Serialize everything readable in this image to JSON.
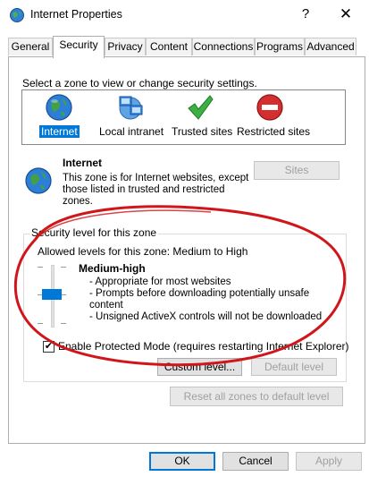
{
  "window": {
    "title": "Internet Properties",
    "help": "?",
    "close": "✕"
  },
  "tabs": [
    {
      "label": "General"
    },
    {
      "label": "Security",
      "active": true
    },
    {
      "label": "Privacy"
    },
    {
      "label": "Content"
    },
    {
      "label": "Connections"
    },
    {
      "label": "Programs"
    },
    {
      "label": "Advanced"
    }
  ],
  "security": {
    "zone_prompt": "Select a zone to view or change security settings.",
    "zones": [
      {
        "label": "Internet",
        "icon": "globe-icon",
        "selected": true
      },
      {
        "label": "Local intranet",
        "icon": "computers-icon"
      },
      {
        "label": "Trusted sites",
        "icon": "checkmark-icon"
      },
      {
        "label": "Restricted sites",
        "icon": "no-entry-icon"
      }
    ],
    "zone_info": {
      "title": "Internet",
      "description": "This zone is for Internet websites, except those listed in trusted and restricted zones."
    },
    "sites_button": "Sites",
    "group_legend": "Security level for this zone",
    "allowed_levels": "Allowed levels for this zone: Medium to High",
    "level": {
      "name": "Medium-high",
      "bullets": [
        "- Appropriate for most websites",
        "- Prompts before downloading potentially unsafe",
        "content",
        "- Unsigned ActiveX controls will not be downloaded"
      ]
    },
    "protected_mode": {
      "label": "Enable Protected Mode (requires restarting Internet Explorer)",
      "checked": true,
      "check_glyph": "✔"
    },
    "custom_level_button": "Custom level...",
    "default_level_button": "Default level",
    "reset_all_button": "Reset all zones to default level"
  },
  "footer": {
    "ok": "OK",
    "cancel": "Cancel",
    "apply": "Apply"
  },
  "colors": {
    "accent": "#0078d7",
    "annotation": "#d0161a"
  }
}
